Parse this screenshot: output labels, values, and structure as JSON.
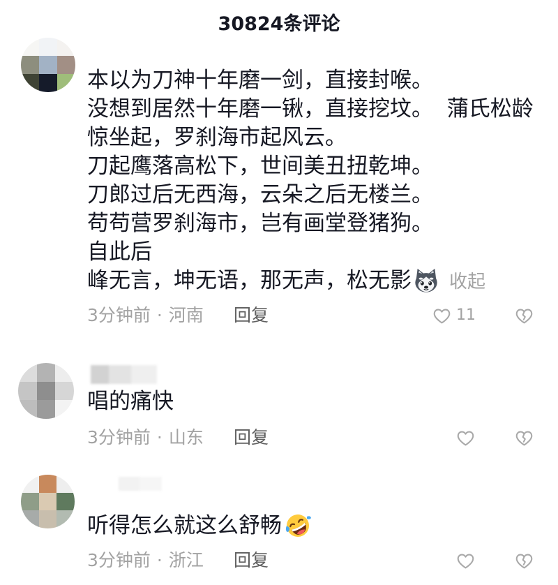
{
  "header": {
    "title": "30824条评论"
  },
  "labels": {
    "reply": "回复",
    "collapse": "收起",
    "dot": "·"
  },
  "icons": {
    "like": "heart-icon",
    "dislike": "broken-heart-icon"
  },
  "theme": {
    "text": "#161823",
    "meta": "#a2a2a2",
    "reply": "#5f5f5f",
    "icon": "#a9a9a9"
  },
  "comments": [
    {
      "lines": [
        "本以为刀神十年磨一剑，直接封喉。",
        "没想到居然十年磨一锹，直接挖坟。  蒲氏松龄",
        "惊坐起，罗刹海市起风云。",
        "刀起鹰落高松下，世间美丑扭乾坤。",
        "刀郎过后无西海，云朵之后无楼兰。",
        "苟苟营罗刹海市，岂有画堂登猪狗。",
        "自此后",
        "峰无言，坤无语，那无声，松无影"
      ],
      "inline_emoji": "husky-dog-emoji",
      "time": "3分钟前",
      "location": "河南",
      "likes": "11"
    },
    {
      "lines": [
        "唱的痛快"
      ],
      "time": "3分钟前",
      "location": "山东"
    },
    {
      "lines": [
        "听得怎么就这么舒畅"
      ],
      "inline_emoji": "rolling-laughing-emoji",
      "time": "3分钟前",
      "location": "浙江"
    }
  ]
}
